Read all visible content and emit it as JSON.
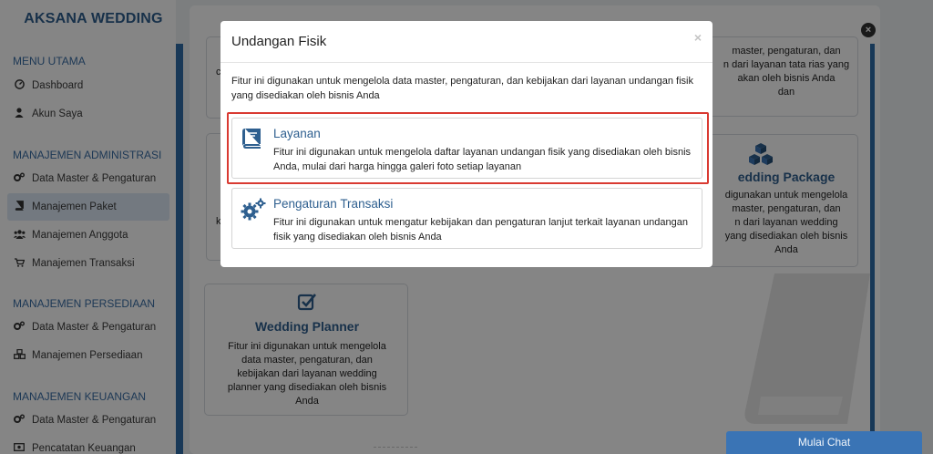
{
  "sidebar": {
    "brand": "AKSANA WEDDING",
    "sections": [
      {
        "title": "MENU UTAMA"
      },
      {
        "title": "MANAJEMEN ADMINISTRASI"
      },
      {
        "title": "MANAJEMEN PERSEDIAAN"
      },
      {
        "title": "MANAJEMEN KEUANGAN"
      }
    ],
    "items": [
      {
        "label": "Dashboard",
        "icon": "dashboard-icon"
      },
      {
        "label": "Akun Saya",
        "icon": "user-icon"
      },
      {
        "label": "Data Master & Pengaturan",
        "icon": "gears-icon"
      },
      {
        "label": "Manajemen Paket",
        "icon": "book-icon"
      },
      {
        "label": "Manajemen Anggota",
        "icon": "users-icon"
      },
      {
        "label": "Manajemen Transaksi",
        "icon": "cart-icon"
      },
      {
        "label": "Data Master & Pengaturan",
        "icon": "gears-icon"
      },
      {
        "label": "Manajemen Persediaan",
        "icon": "cubes-icon"
      },
      {
        "label": "Data Master & Pengaturan",
        "icon": "gears-icon"
      },
      {
        "label": "Pencatatan Keuangan",
        "icon": "money-icon"
      }
    ]
  },
  "background_cards": {
    "top_left_fragment": "c",
    "mid_left_fragment": "k",
    "top_right": "master, pengaturan, dan\nn dari layanan tata rias yang\nakan oleh bisnis Anda\ndan",
    "package_title": "edding Package",
    "package_desc": "digunakan untuk mengelola\nmaster, pengaturan, dan\nn dari layanan wedding\nyang disediakan oleh bisnis\nAnda",
    "planner_title": "Wedding Planner",
    "planner_desc": "Fitur ini digunakan untuk mengelola\ndata master, pengaturan, dan\nkebijakan dari layanan wedding\nplanner yang disediakan oleh bisnis\nAnda"
  },
  "modal": {
    "title": "Undangan Fisik",
    "close": "×",
    "intro": "Fitur ini digunakan untuk mengelola data master, pengaturan, dan kebijakan dari layanan undangan fisik yang disediakan oleh bisnis Anda",
    "options": [
      {
        "title": "Layanan",
        "desc": "Fitur ini digunakan untuk mengelola daftar layanan undangan fisik yang disediakan oleh bisnis Anda, mulai dari harga hingga galeri foto setiap layanan",
        "icon": "book-icon"
      },
      {
        "title": "Pengaturan Transaksi",
        "desc": "Fitur ini digunakan untuk mengatur kebijakan dan pengaturan lanjut terkait layanan undangan fisik yang disediakan oleh bisnis Anda",
        "icon": "gears-icon"
      }
    ]
  },
  "chat": {
    "label": "Mulai Chat"
  },
  "colors": {
    "accent": "#2e5f8f",
    "highlight": "#d93a32",
    "chat": "#3a74b5"
  }
}
